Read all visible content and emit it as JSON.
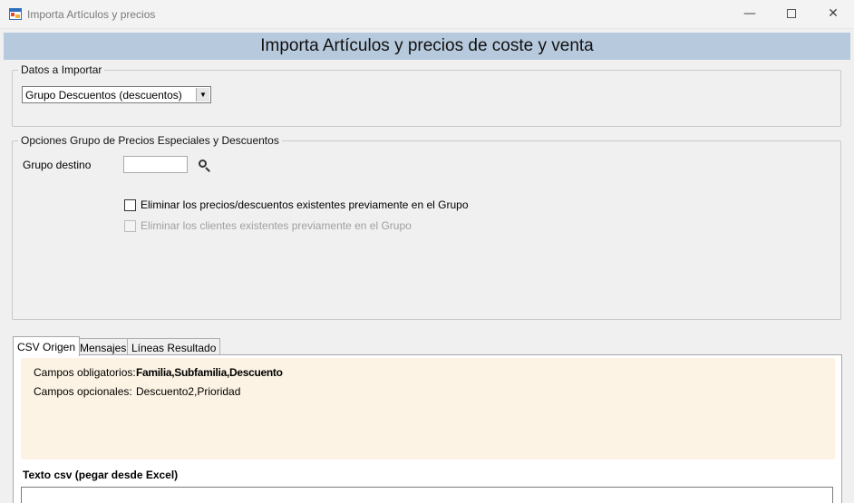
{
  "window": {
    "title": "Importa Artículos y precios",
    "minimize_glyph": "—",
    "close_glyph": "✕"
  },
  "banner": {
    "title": "Importa Artículos y precios de coste y venta"
  },
  "datos_importar": {
    "legend": "Datos a Importar",
    "selected": "Grupo Descuentos (descuentos)",
    "arrow_glyph": "▼"
  },
  "opciones": {
    "legend": "Opciones Grupo de Precios Especiales y Descuentos",
    "grupo_destino_label": "Grupo destino",
    "grupo_destino_value": "",
    "checkbox_eliminar_precios": {
      "label": "Eliminar los precios/descuentos existentes previamente en el Grupo",
      "checked": false,
      "enabled": true
    },
    "checkbox_eliminar_clientes": {
      "label": "Eliminar los clientes existentes previamente en el Grupo",
      "checked": false,
      "enabled": false
    }
  },
  "tabs": [
    {
      "label": "CSV Origen",
      "active": true
    },
    {
      "label": "Mensajes",
      "active": false
    },
    {
      "label": "Líneas Resultado",
      "active": false
    }
  ],
  "csv_origen": {
    "obligatorios_label": "Campos obligatorios:",
    "obligatorios_value": "Familia,Subfamilia,Descuento",
    "opcionales_label": "Campos opcionales:",
    "opcionales_value": "Descuento2,Prioridad",
    "texto_label": "Texto csv (pegar desde Excel)",
    "texto_value": "",
    "scroll_up_glyph": "▲"
  },
  "icons": {
    "app": "app-window-icon",
    "search": "search-icon",
    "minimize": "minimize-icon",
    "maximize": "maximize-icon",
    "close": "close-icon"
  }
}
